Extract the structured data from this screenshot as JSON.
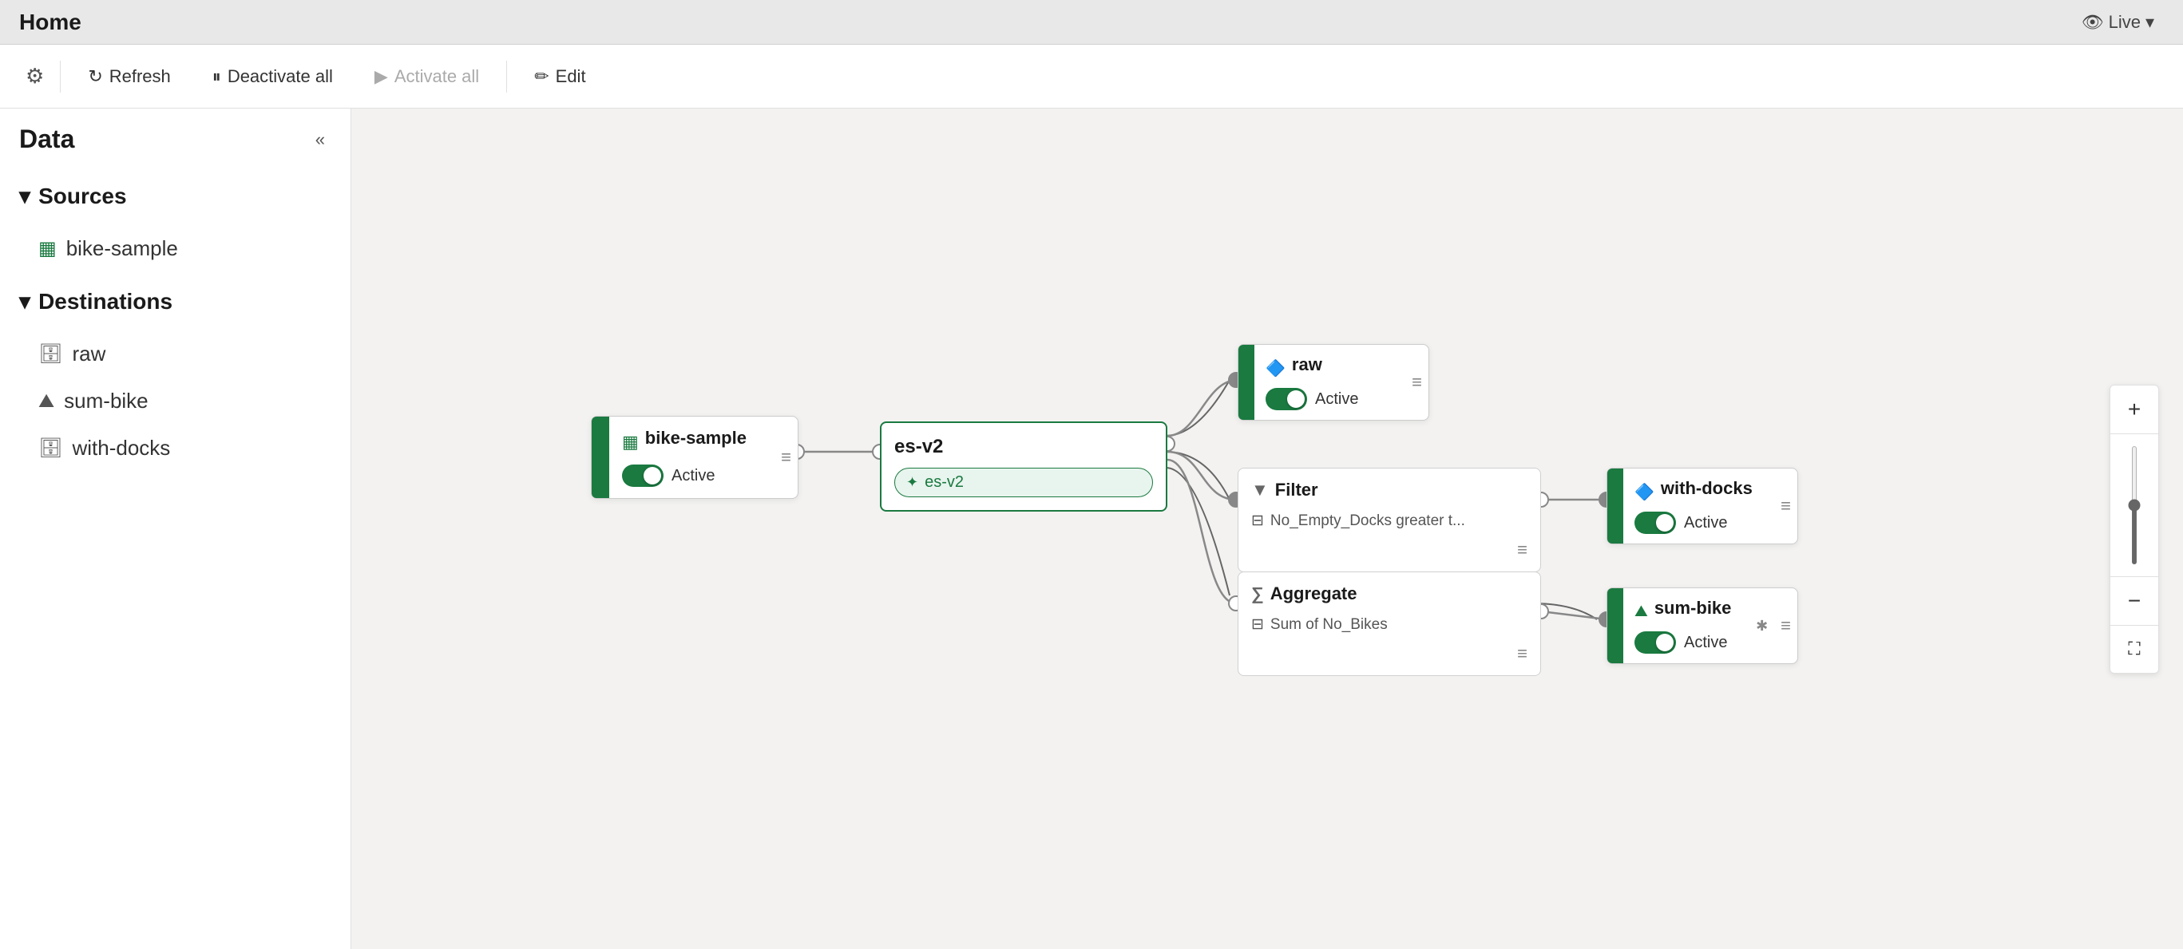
{
  "titleBar": {
    "title": "Home",
    "liveBadge": "Live",
    "liveIcon": "eye"
  },
  "toolbar": {
    "settings_label": "⚙",
    "refresh_label": "Refresh",
    "deactivate_label": "Deactivate all",
    "activate_label": "Activate all",
    "edit_label": "Edit",
    "refresh_icon": "↻",
    "deactivate_icon": "⏸",
    "activate_icon": "▶",
    "edit_icon": "✏"
  },
  "sidebar": {
    "title": "Data",
    "collapse_icon": "«",
    "sections": [
      {
        "id": "sources",
        "label": "Sources",
        "expanded": true,
        "items": [
          {
            "id": "bike-sample",
            "label": "bike-sample",
            "icon": "table"
          }
        ]
      },
      {
        "id": "destinations",
        "label": "Destinations",
        "expanded": true,
        "items": [
          {
            "id": "raw",
            "label": "raw",
            "icon": "storage"
          },
          {
            "id": "sum-bike",
            "label": "sum-bike",
            "icon": "mountain"
          },
          {
            "id": "with-docks",
            "label": "with-docks",
            "icon": "storage"
          }
        ]
      }
    ]
  },
  "canvas": {
    "nodes": {
      "source": {
        "title": "bike-sample",
        "status": "Active",
        "active": true
      },
      "esv2": {
        "title": "es-v2",
        "pill": "es-v2"
      },
      "raw": {
        "title": "raw",
        "status": "Active",
        "active": true
      },
      "filter": {
        "title": "Filter",
        "condition": "No_Empty_Docks greater t..."
      },
      "withDocks": {
        "title": "with-docks",
        "status": "Active",
        "active": true
      },
      "aggregate": {
        "title": "Aggregate",
        "condition": "Sum of No_Bikes"
      },
      "sumBike": {
        "title": "sum-bike",
        "status": "Active",
        "active": true
      }
    },
    "zoom": {
      "plus": "+",
      "minus": "−",
      "fit": "⛶"
    }
  }
}
